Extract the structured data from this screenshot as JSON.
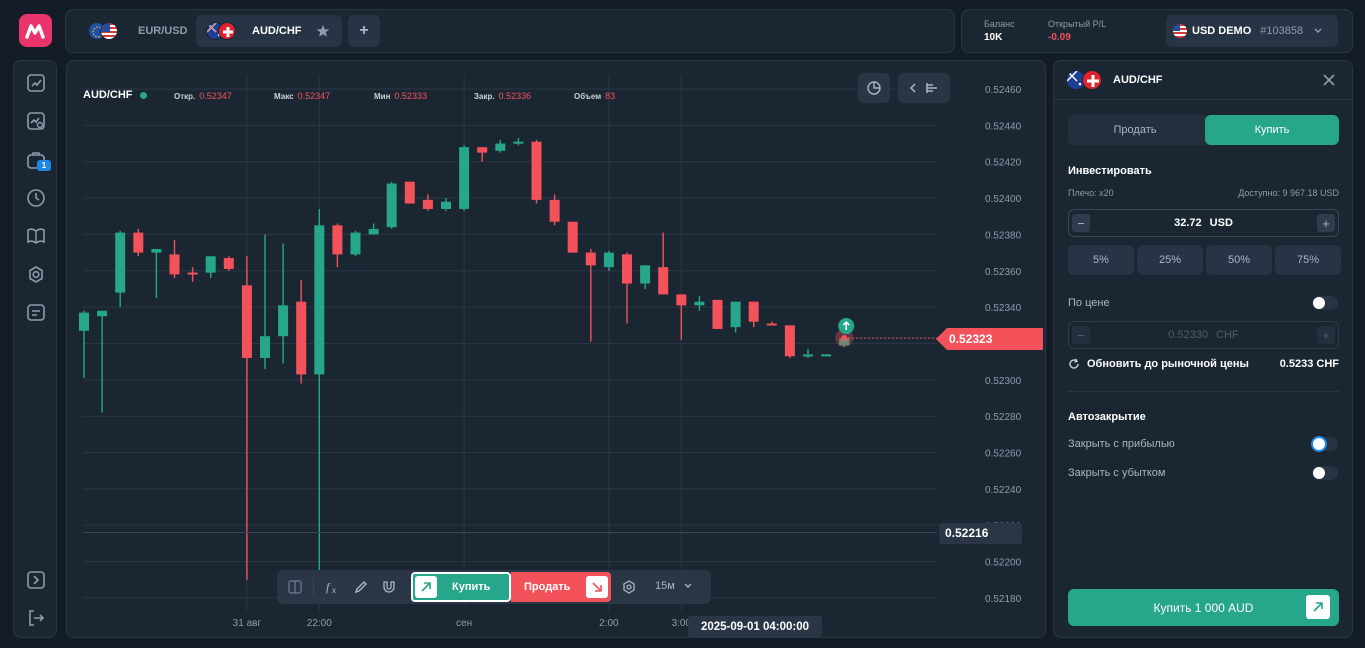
{
  "tabs": [
    {
      "label": "EUR/USD",
      "active": false
    },
    {
      "label": "AUD/CHF",
      "active": true
    }
  ],
  "add_tab_label": "+",
  "account": {
    "balance_label": "Баланс",
    "balance_value": "10K",
    "pl_label": "Открытый P/L",
    "pl_value": "-0.09",
    "account_name": "USD DEMO",
    "account_id": "#103858"
  },
  "sidenav": {
    "badge": "1"
  },
  "chart": {
    "symbol": "AUD/CHF",
    "ohlc": [
      {
        "label": "Откр.",
        "value": "0.52347"
      },
      {
        "label": "Макс",
        "value": "0.52347"
      },
      {
        "label": "Мин",
        "value": "0.52333"
      },
      {
        "label": "Закр.",
        "value": "0.52336"
      },
      {
        "label": "Объем",
        "value": "83"
      }
    ],
    "current_price": "0.52323",
    "low_price": "0.52216",
    "crosshair_date": "2025-09-01 04:00:00",
    "timeframe": "15м",
    "buy_label": "Купить",
    "sell_label": "Продать",
    "colors": {
      "up": "#26a68b",
      "down": "#f4525a",
      "bg": "#1b2633",
      "grid": "#2a3646"
    }
  },
  "chart_data": {
    "type": "candlestick",
    "price_axis_ticks": [
      "0.52460",
      "0.52440",
      "0.52420",
      "0.52400",
      "0.52380",
      "0.52360",
      "0.52340",
      "0.52320",
      "0.52300",
      "0.52280",
      "0.52260",
      "0.52240",
      "0.52220",
      "0.52200",
      "0.52180"
    ],
    "time_axis_ticks": [
      "31 авг",
      "22:00",
      "сен",
      "2:00",
      "3:00"
    ],
    "ylim": [
      0.52175,
      0.5247
    ],
    "candles": [
      {
        "o": 0.52327,
        "h": 0.52338,
        "l": 0.52301,
        "c": 0.52337
      },
      {
        "o": 0.52335,
        "h": 0.52336,
        "l": 0.52282,
        "c": 0.52338
      },
      {
        "o": 0.52348,
        "h": 0.52382,
        "l": 0.5234,
        "c": 0.52381
      },
      {
        "o": 0.52381,
        "h": 0.52383,
        "l": 0.52368,
        "c": 0.5237
      },
      {
        "o": 0.5237,
        "h": 0.52372,
        "l": 0.52345,
        "c": 0.52372
      },
      {
        "o": 0.52369,
        "h": 0.52377,
        "l": 0.52356,
        "c": 0.52358
      },
      {
        "o": 0.52359,
        "h": 0.52362,
        "l": 0.52354,
        "c": 0.52358
      },
      {
        "o": 0.52359,
        "h": 0.52368,
        "l": 0.52356,
        "c": 0.52368
      },
      {
        "o": 0.52367,
        "h": 0.52368,
        "l": 0.5236,
        "c": 0.52361
      },
      {
        "o": 0.52352,
        "h": 0.52368,
        "l": 0.5219,
        "c": 0.52312
      },
      {
        "o": 0.52312,
        "h": 0.5238,
        "l": 0.52306,
        "c": 0.52324
      },
      {
        "o": 0.52324,
        "h": 0.52375,
        "l": 0.52309,
        "c": 0.52341
      },
      {
        "o": 0.52343,
        "h": 0.52355,
        "l": 0.52298,
        "c": 0.52303
      },
      {
        "o": 0.52303,
        "h": 0.52394,
        "l": 0.52182,
        "c": 0.52385
      },
      {
        "o": 0.52385,
        "h": 0.52386,
        "l": 0.52362,
        "c": 0.52369
      },
      {
        "o": 0.52369,
        "h": 0.52382,
        "l": 0.52368,
        "c": 0.52381
      },
      {
        "o": 0.5238,
        "h": 0.52386,
        "l": 0.5238,
        "c": 0.52383
      },
      {
        "o": 0.52384,
        "h": 0.52409,
        "l": 0.52383,
        "c": 0.52408
      },
      {
        "o": 0.52409,
        "h": 0.52408,
        "l": 0.52397,
        "c": 0.52397
      },
      {
        "o": 0.52399,
        "h": 0.52402,
        "l": 0.52393,
        "c": 0.52394
      },
      {
        "o": 0.52394,
        "h": 0.524,
        "l": 0.52393,
        "c": 0.52398
      },
      {
        "o": 0.52394,
        "h": 0.52429,
        "l": 0.52393,
        "c": 0.52428
      },
      {
        "o": 0.52428,
        "h": 0.52426,
        "l": 0.5242,
        "c": 0.52425
      },
      {
        "o": 0.52426,
        "h": 0.52432,
        "l": 0.52425,
        "c": 0.5243
      },
      {
        "o": 0.5243,
        "h": 0.52433,
        "l": 0.52429,
        "c": 0.52431
      },
      {
        "o": 0.52431,
        "h": 0.52432,
        "l": 0.52397,
        "c": 0.52399
      },
      {
        "o": 0.52399,
        "h": 0.52402,
        "l": 0.52385,
        "c": 0.52387
      },
      {
        "o": 0.52387,
        "h": 0.52385,
        "l": 0.5237,
        "c": 0.5237
      },
      {
        "o": 0.5237,
        "h": 0.52372,
        "l": 0.52321,
        "c": 0.52363
      },
      {
        "o": 0.52362,
        "h": 0.52371,
        "l": 0.5236,
        "c": 0.5237
      },
      {
        "o": 0.52369,
        "h": 0.5237,
        "l": 0.52331,
        "c": 0.52353
      },
      {
        "o": 0.52353,
        "h": 0.52363,
        "l": 0.5235,
        "c": 0.52363
      },
      {
        "o": 0.52362,
        "h": 0.52381,
        "l": 0.52347,
        "c": 0.52347
      },
      {
        "o": 0.52347,
        "h": 0.5234,
        "l": 0.52322,
        "c": 0.52341
      },
      {
        "o": 0.52341,
        "h": 0.52346,
        "l": 0.52338,
        "c": 0.52343
      },
      {
        "o": 0.52344,
        "h": 0.52343,
        "l": 0.52328,
        "c": 0.52328
      },
      {
        "o": 0.52329,
        "h": 0.52343,
        "l": 0.52326,
        "c": 0.52343
      },
      {
        "o": 0.52343,
        "h": 0.52343,
        "l": 0.52329,
        "c": 0.52332
      },
      {
        "o": 0.52331,
        "h": 0.52332,
        "l": 0.5233,
        "c": 0.5233
      },
      {
        "o": 0.5233,
        "h": 0.5233,
        "l": 0.52312,
        "c": 0.52313
      },
      {
        "o": 0.52313,
        "h": 0.52317,
        "l": 0.52312,
        "c": 0.52314
      },
      {
        "o": 0.52314,
        "h": 0.52314,
        "l": 0.52313,
        "c": 0.52314
      },
      {
        "o": 0.52319,
        "h": 0.52323,
        "l": 0.52318,
        "c": 0.52323
      }
    ]
  },
  "trade": {
    "symbol": "AUD/CHF",
    "sell_label": "Продать",
    "buy_label": "Купить",
    "invest_label": "Инвестировать",
    "leverage": "Плечо: x20",
    "available": "Доступно: 9 967.18 USD",
    "amount": "32.72",
    "amount_currency": "USD",
    "percents": [
      "5%",
      "25%",
      "50%",
      "75%"
    ],
    "by_price_label": "По цене",
    "price_placeholder": "0.52330",
    "price_currency": "CHF",
    "update_label": "Обновить до рыночной цены",
    "market_price": "0.5233 CHF",
    "autoclose_label": "Автозакрытие",
    "take_profit_label": "Закрыть с прибылью",
    "stop_loss_label": "Закрыть с убытком",
    "buy_button_label": "Купить 1 000 AUD"
  }
}
